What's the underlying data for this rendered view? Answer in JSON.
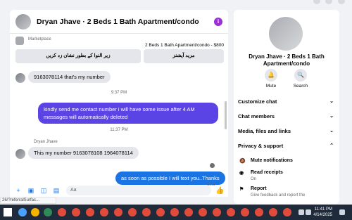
{
  "chat": {
    "title": "Dryan Jhave · 2 Beds 1 Bath Apartment/condo",
    "marketplace_label": "Marketplace",
    "listing_title": "2 Beds 1 Bath Apartment/condo - $800",
    "button_map": "زیر النوا کے بطور نشان زد کریں",
    "button_more": "مزید آپشنز",
    "composer_placeholder": "Aa",
    "messages": {
      "m1": "9163078114 that's my number",
      "ts1": "9:37 PM",
      "m2": "kindly send me contact number i will have some issue after 4 AM messages will automatically deleted",
      "ts2": "11:37 PM",
      "sender": "Dryan Jhave",
      "m3": "This my number 9163078108 1964078114",
      "m4": "as soon as possible I will text you..Thanks",
      "status": "Sent"
    }
  },
  "info": {
    "title": "Dryan Jhave · 2 Beds 1 Bath Apartment/condo",
    "mute": "Mute",
    "search": "Search",
    "rows": [
      "Customize chat",
      "Chat members",
      "Media, files and links",
      "Privacy & support"
    ],
    "mute_notifications": "Mute notifications",
    "read_receipts": "Read receipts",
    "read_receipts_state": "On",
    "report": "Report",
    "report_hint": "Give feedback and report the"
  },
  "url_hint": "26/?referralSurfac...",
  "taskbar": {
    "time": "11:41 PM",
    "date": "4/14/2025"
  },
  "colors": {
    "outgoing_purple": "#5b44e6",
    "outgoing_blue": "#1b74e4",
    "accent": "#9a2fd6"
  }
}
